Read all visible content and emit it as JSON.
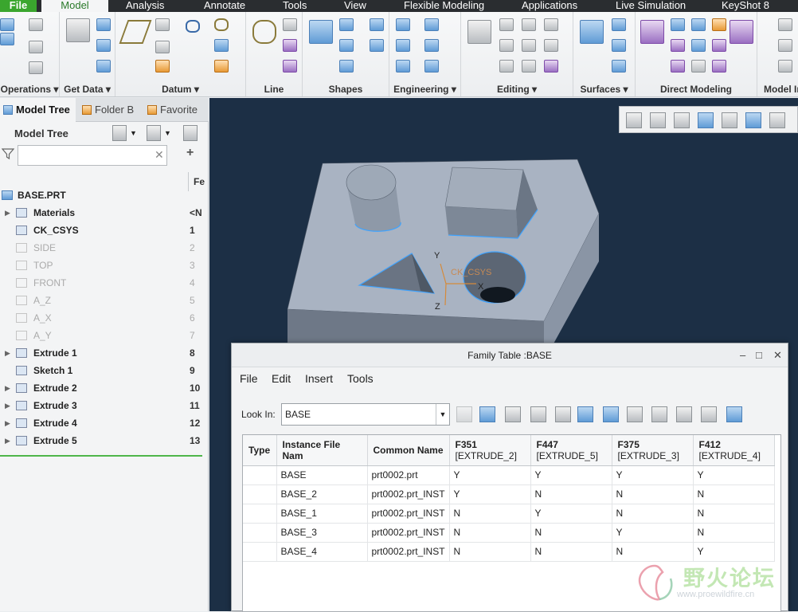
{
  "menu": {
    "file": "File",
    "model": "Model",
    "items": [
      "Analysis",
      "Annotate",
      "Tools",
      "View",
      "Flexible Modeling",
      "Applications",
      "Live Simulation",
      "KeyShot 8"
    ]
  },
  "ribbon": {
    "groups": [
      "Operations",
      "Get Data",
      "Datum",
      "Line",
      "Shapes",
      "Engineering",
      "Editing",
      "Surfaces",
      "Direct Modeling",
      "Model In"
    ]
  },
  "left_panel": {
    "tabs": [
      "Model Tree",
      "Folder B",
      "Favorite"
    ],
    "title": "Model Tree",
    "column_header": "Fe",
    "tree": [
      {
        "label": "BASE.PRT",
        "num": "",
        "dim": false,
        "arrow": false
      },
      {
        "label": "Materials",
        "num": "<N",
        "dim": false,
        "arrow": true
      },
      {
        "label": "CK_CSYS",
        "num": "1",
        "dim": false,
        "arrow": false
      },
      {
        "label": "SIDE",
        "num": "2",
        "dim": true,
        "arrow": false
      },
      {
        "label": "TOP",
        "num": "3",
        "dim": true,
        "arrow": false
      },
      {
        "label": "FRONT",
        "num": "4",
        "dim": true,
        "arrow": false
      },
      {
        "label": "A_Z",
        "num": "5",
        "dim": true,
        "arrow": false
      },
      {
        "label": "A_X",
        "num": "6",
        "dim": true,
        "arrow": false
      },
      {
        "label": "A_Y",
        "num": "7",
        "dim": true,
        "arrow": false
      },
      {
        "label": "Extrude 1",
        "num": "8",
        "dim": false,
        "arrow": true
      },
      {
        "label": "Sketch 1",
        "num": "9",
        "dim": false,
        "arrow": false
      },
      {
        "label": "Extrude 2",
        "num": "10",
        "dim": false,
        "arrow": true
      },
      {
        "label": "Extrude 3",
        "num": "11",
        "dim": false,
        "arrow": true
      },
      {
        "label": "Extrude 4",
        "num": "12",
        "dim": false,
        "arrow": true
      },
      {
        "label": "Extrude 5",
        "num": "13",
        "dim": false,
        "arrow": true
      }
    ]
  },
  "viewport": {
    "csys_label": "CK_CSYS",
    "axis_y": "Y",
    "axis_x": "X",
    "axis_z": "Z"
  },
  "dialog": {
    "title": "Family Table :BASE",
    "menus": [
      "File",
      "Edit",
      "Insert",
      "Tools"
    ],
    "lookin_label": "Look In:",
    "lookin_value": "BASE",
    "columns": [
      {
        "l1": "Type",
        "l2": ""
      },
      {
        "l1": "Instance File Nam",
        "l2": ""
      },
      {
        "l1": "Common Name",
        "l2": ""
      },
      {
        "l1": "F351",
        "l2": "[EXTRUDE_2]"
      },
      {
        "l1": "F447",
        "l2": "[EXTRUDE_5]"
      },
      {
        "l1": "F375",
        "l2": "[EXTRUDE_3]"
      },
      {
        "l1": "F412",
        "l2": "[EXTRUDE_4]"
      }
    ],
    "rows": [
      [
        "",
        "BASE",
        "prt0002.prt",
        "Y",
        "Y",
        "Y",
        "Y"
      ],
      [
        "",
        "BASE_2",
        "prt0002.prt_INST",
        "Y",
        "N",
        "N",
        "N"
      ],
      [
        "",
        "BASE_1",
        "prt0002.prt_INST",
        "N",
        "Y",
        "N",
        "N"
      ],
      [
        "",
        "BASE_3",
        "prt0002.prt_INST",
        "N",
        "N",
        "Y",
        "N"
      ],
      [
        "",
        "BASE_4",
        "prt0002.prt_INST",
        "N",
        "N",
        "N",
        "Y"
      ]
    ]
  },
  "watermark": {
    "cn": "野火论坛",
    "url": "www.proewildfire.cn"
  },
  "colors": {
    "accent_green": "#3aa62e",
    "viewport_bg": "#1c2f45",
    "part_face": "#a9b3c2"
  }
}
